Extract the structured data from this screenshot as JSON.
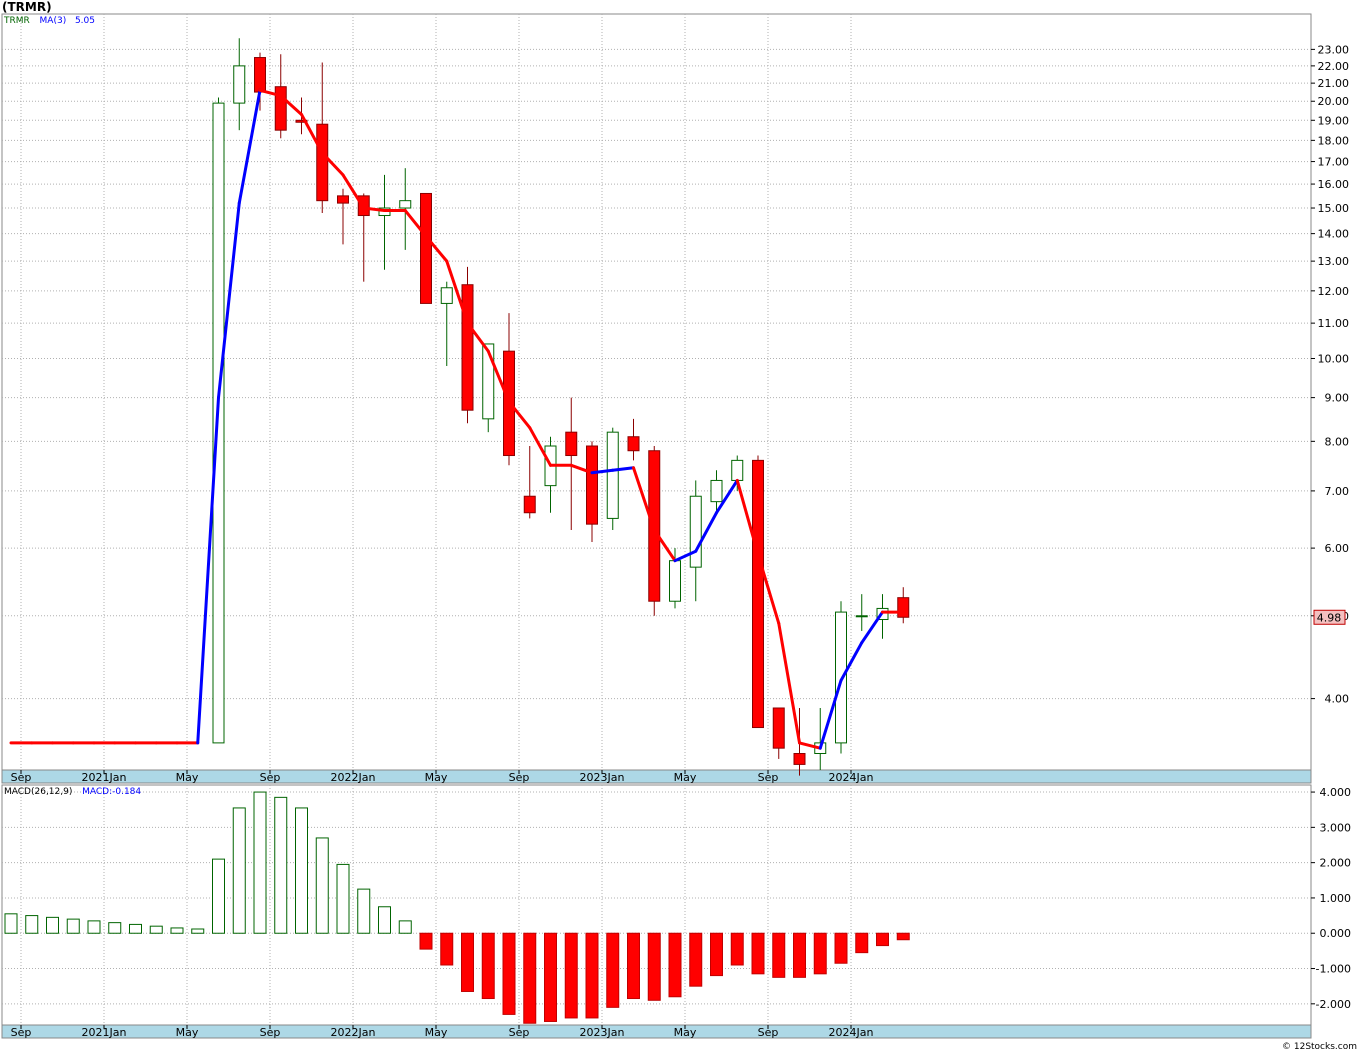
{
  "ticker_label": "(TRMR)",
  "credit": "© 12Stocks.com",
  "colors": {
    "up": "#006400",
    "down": "#ff0000",
    "ma_up": "#0000ff",
    "ma_down": "#ff0000",
    "axis_band": "#add8e6",
    "price_tag_bg": "#f4c0c0"
  },
  "chart_data": [
    {
      "type": "candlestick",
      "title": "(TRMR)",
      "frequency": "monthly",
      "y_scale": "log",
      "ylim": [
        3.3,
        25.3
      ],
      "grid": true,
      "legend": {
        "symbol": "TRMR",
        "ma_label": "MA(3)",
        "ma_value": "5.05"
      },
      "last_price": "4.98",
      "y_ticks": [
        "4.00",
        "5.00",
        "6.00",
        "7.00",
        "8.00",
        "9.00",
        "10.00",
        "11.00",
        "12.00",
        "13.00",
        "14.00",
        "15.00",
        "16.00",
        "17.00",
        "18.00",
        "19.00",
        "20.00",
        "21.00",
        "22.00",
        "23.00"
      ],
      "x_ticks": [
        {
          "label": "Sep",
          "index": 0
        },
        {
          "label": "2021Jan",
          "index": 4
        },
        {
          "label": "May",
          "index": 8
        },
        {
          "label": "Sep",
          "index": 12
        },
        {
          "label": "2022Jan",
          "index": 16
        },
        {
          "label": "May",
          "index": 20
        },
        {
          "label": "Sep",
          "index": 24
        },
        {
          "label": "2023Jan",
          "index": 28
        },
        {
          "label": "May",
          "index": 32
        },
        {
          "label": "Sep",
          "index": 36
        },
        {
          "label": "2024Jan",
          "index": 40
        }
      ],
      "candles": [
        {
          "o": null,
          "h": null,
          "l": null,
          "c": 3.55
        },
        {
          "o": null,
          "h": null,
          "l": null,
          "c": 3.55
        },
        {
          "o": null,
          "h": null,
          "l": null,
          "c": 3.55
        },
        {
          "o": null,
          "h": null,
          "l": null,
          "c": 3.55
        },
        {
          "o": null,
          "h": null,
          "l": null,
          "c": 3.55
        },
        {
          "o": null,
          "h": null,
          "l": null,
          "c": 3.55
        },
        {
          "o": null,
          "h": null,
          "l": null,
          "c": 3.55
        },
        {
          "o": null,
          "h": null,
          "l": null,
          "c": 3.55
        },
        {
          "o": null,
          "h": null,
          "l": null,
          "c": 3.55
        },
        {
          "o": null,
          "h": null,
          "l": null,
          "c": 3.55
        },
        {
          "o": 3.55,
          "h": 20.2,
          "l": 3.55,
          "c": 19.9
        },
        {
          "o": 19.9,
          "h": 23.7,
          "l": 18.5,
          "c": 22.0
        },
        {
          "o": 22.5,
          "h": 22.8,
          "l": 19.5,
          "c": 20.5
        },
        {
          "o": 20.8,
          "h": 22.7,
          "l": 18.1,
          "c": 18.5
        },
        {
          "o": 19.0,
          "h": 20.2,
          "l": 18.3,
          "c": 18.9
        },
        {
          "o": 18.8,
          "h": 22.2,
          "l": 14.8,
          "c": 15.3
        },
        {
          "o": 15.5,
          "h": 15.8,
          "l": 13.6,
          "c": 15.2
        },
        {
          "o": 15.5,
          "h": 15.6,
          "l": 12.3,
          "c": 14.7
        },
        {
          "o": 14.7,
          "h": 16.4,
          "l": 12.7,
          "c": 15.0
        },
        {
          "o": 15.0,
          "h": 16.7,
          "l": 13.4,
          "c": 15.3
        },
        {
          "o": 15.6,
          "h": 15.6,
          "l": 11.6,
          "c": 11.6
        },
        {
          "o": 11.6,
          "h": 12.3,
          "l": 9.8,
          "c": 12.1
        },
        {
          "o": 12.2,
          "h": 12.8,
          "l": 8.4,
          "c": 8.7
        },
        {
          "o": 8.5,
          "h": 10.4,
          "l": 8.2,
          "c": 10.4
        },
        {
          "o": 10.2,
          "h": 11.3,
          "l": 7.5,
          "c": 7.7
        },
        {
          "o": 6.9,
          "h": 7.9,
          "l": 6.5,
          "c": 6.6
        },
        {
          "o": 7.1,
          "h": 8.1,
          "l": 6.6,
          "c": 7.9
        },
        {
          "o": 8.2,
          "h": 9.0,
          "l": 6.3,
          "c": 7.7
        },
        {
          "o": 7.9,
          "h": 8.0,
          "l": 6.1,
          "c": 6.4
        },
        {
          "o": 6.5,
          "h": 8.3,
          "l": 6.3,
          "c": 8.2
        },
        {
          "o": 8.1,
          "h": 8.5,
          "l": 7.6,
          "c": 7.8
        },
        {
          "o": 7.8,
          "h": 7.9,
          "l": 5.0,
          "c": 5.2
        },
        {
          "o": 5.2,
          "h": 6.0,
          "l": 5.1,
          "c": 5.8
        },
        {
          "o": 5.7,
          "h": 7.2,
          "l": 5.2,
          "c": 6.9
        },
        {
          "o": 6.8,
          "h": 7.4,
          "l": 6.6,
          "c": 7.2
        },
        {
          "o": 7.2,
          "h": 7.7,
          "l": 7.0,
          "c": 7.6
        },
        {
          "o": 7.6,
          "h": 7.7,
          "l": 3.7,
          "c": 3.7
        },
        {
          "o": 3.9,
          "h": 3.9,
          "l": 3.4,
          "c": 3.5
        },
        {
          "o": 3.45,
          "h": 3.9,
          "l": 3.25,
          "c": 3.35
        },
        {
          "o": 3.45,
          "h": 3.9,
          "l": 3.3,
          "c": 3.55
        },
        {
          "o": 3.55,
          "h": 5.2,
          "l": 3.45,
          "c": 5.05
        },
        {
          "o": 5.0,
          "h": 5.3,
          "l": 4.8,
          "c": 5.0
        },
        {
          "o": 4.95,
          "h": 5.3,
          "l": 4.7,
          "c": 5.1
        },
        {
          "o": 5.25,
          "h": 5.4,
          "l": 4.9,
          "c": 4.98
        }
      ],
      "ma3": [
        3.55,
        3.55,
        3.55,
        3.55,
        3.55,
        3.55,
        3.55,
        3.55,
        3.55,
        3.55,
        9.0,
        15.2,
        20.6,
        20.3,
        19.3,
        17.4,
        16.4,
        15.0,
        14.9,
        14.9,
        13.9,
        13.0,
        11.0,
        10.2,
        8.9,
        8.3,
        7.5,
        7.5,
        7.35,
        7.4,
        7.45,
        6.3,
        5.8,
        5.95,
        6.6,
        7.2,
        5.9,
        4.9,
        3.55,
        3.5,
        4.2,
        4.65,
        5.05,
        5.05
      ]
    },
    {
      "type": "bar",
      "title": "MACD(26,12,9)",
      "legend": {
        "label": "MACD(26,12,9)",
        "value_label": "MACD:",
        "value": "-0.184"
      },
      "ylim": [
        -2.6,
        4.2
      ],
      "y_ticks": [
        "-2.000",
        "-1.000",
        "0.000",
        "1.000",
        "2.000",
        "3.000",
        "4.000"
      ],
      "x_ticks": [
        {
          "label": "Sep",
          "index": 0
        },
        {
          "label": "2021Jan",
          "index": 4
        },
        {
          "label": "May",
          "index": 8
        },
        {
          "label": "Sep",
          "index": 12
        },
        {
          "label": "2022Jan",
          "index": 16
        },
        {
          "label": "May",
          "index": 20
        },
        {
          "label": "Sep",
          "index": 24
        },
        {
          "label": "2023Jan",
          "index": 28
        },
        {
          "label": "May",
          "index": 32
        },
        {
          "label": "Sep",
          "index": 36
        },
        {
          "label": "2024Jan",
          "index": 40
        }
      ],
      "values": [
        0.55,
        0.5,
        0.45,
        0.4,
        0.35,
        0.3,
        0.25,
        0.2,
        0.15,
        0.12,
        2.1,
        3.55,
        4.0,
        3.85,
        3.55,
        2.7,
        1.95,
        1.25,
        0.75,
        0.35,
        -0.45,
        -0.9,
        -1.65,
        -1.85,
        -2.3,
        -2.55,
        -2.5,
        -2.4,
        -2.4,
        -2.1,
        -1.85,
        -1.9,
        -1.8,
        -1.5,
        -1.2,
        -0.9,
        -1.15,
        -1.25,
        -1.25,
        -1.15,
        -0.85,
        -0.55,
        -0.35,
        -0.184
      ]
    }
  ]
}
